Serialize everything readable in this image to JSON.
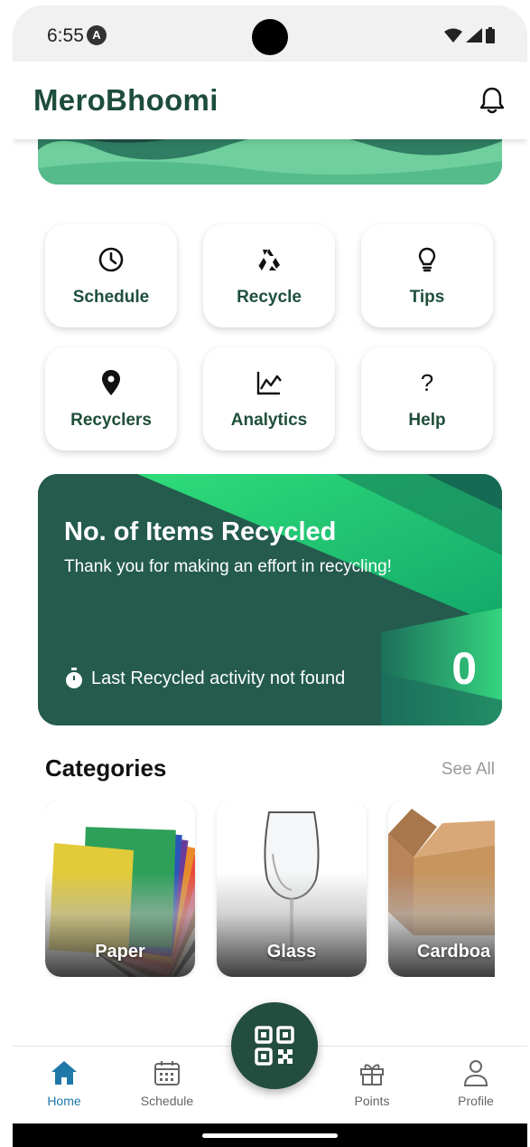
{
  "status_bar": {
    "time": "6:55",
    "badge_letter": "A"
  },
  "app": {
    "title": "MeroBhoomi"
  },
  "actions": [
    {
      "label": "Schedule",
      "icon": "clock-icon"
    },
    {
      "label": "Recycle",
      "icon": "recycle-icon"
    },
    {
      "label": "Tips",
      "icon": "lightbulb-icon"
    },
    {
      "label": "Recyclers",
      "icon": "location-pin-icon"
    },
    {
      "label": "Analytics",
      "icon": "line-chart-icon"
    },
    {
      "label": "Help",
      "icon": "question-mark-icon",
      "glyph": "?"
    }
  ],
  "stats": {
    "title": "No. of Items Recycled",
    "subtitle": "Thank you for making an effort in recycling!",
    "last_activity": "Last Recycled activity not found",
    "count": "0"
  },
  "categories": {
    "heading": "Categories",
    "see_all": "See All",
    "items": [
      {
        "label": "Paper"
      },
      {
        "label": "Glass"
      },
      {
        "label": "Cardboa"
      }
    ]
  },
  "nav": {
    "items": [
      {
        "label": "Home",
        "icon": "home-icon",
        "active": true
      },
      {
        "label": "Schedule",
        "icon": "calendar-icon"
      },
      {
        "label": "Points",
        "icon": "gift-icon"
      },
      {
        "label": "Profile",
        "icon": "person-icon"
      }
    ],
    "fab_icon": "qr-code-icon"
  },
  "colors": {
    "brand_green": "#1d4d3a",
    "fab_green": "#234d3e",
    "active_blue": "#1e78a8",
    "card_teal": "#235c4e",
    "accent_green": "#2ee27a"
  }
}
